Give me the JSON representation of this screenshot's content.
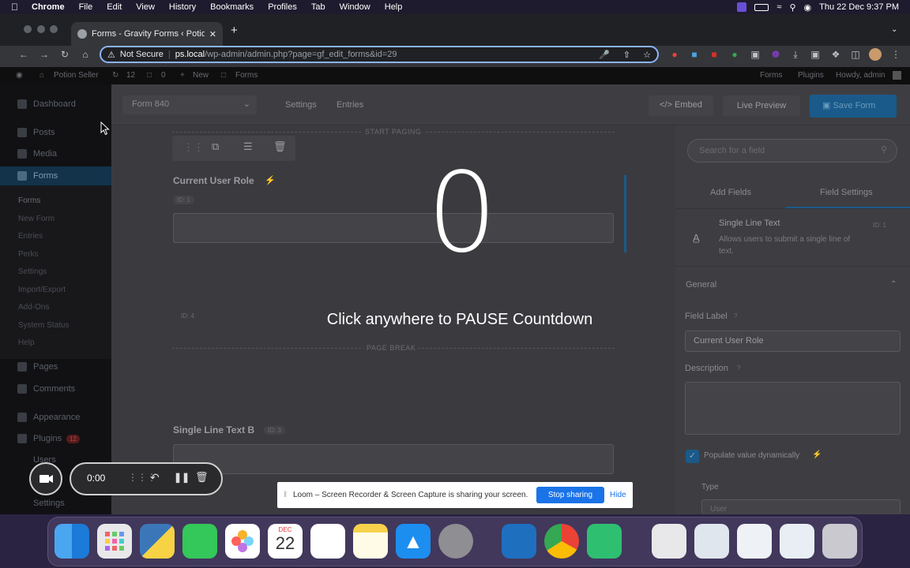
{
  "menubar": {
    "app": "Chrome",
    "items": [
      "File",
      "Edit",
      "View",
      "History",
      "Bookmarks",
      "Profiles",
      "Tab",
      "Window",
      "Help"
    ],
    "datetime": "Thu 22 Dec  9:37 PM"
  },
  "browser": {
    "tab_title": "Forms - Gravity Forms ‹ Potion",
    "security": "Not Secure",
    "url_host": "ps.local",
    "url_path": "/wp-admin/admin.php?page=gf_edit_forms&id=29"
  },
  "adminbar": {
    "site": "Potion Seller",
    "updates": "12",
    "comments": "0",
    "new": "New",
    "forms": "Forms",
    "right_forms": "Forms",
    "right_plugins": "Plugins",
    "howdy": "Howdy, admin"
  },
  "sidebar": {
    "dashboard": "Dashboard",
    "posts": "Posts",
    "media": "Media",
    "forms": "Forms",
    "forms_sub": [
      "Forms",
      "New Form",
      "Entries",
      "Perks",
      "Settings",
      "Import/Export",
      "Add-Ons",
      "System Status",
      "Help"
    ],
    "pages": "Pages",
    "comments": "Comments",
    "appearance": "Appearance",
    "plugins": "Plugins",
    "plugins_badge": "12",
    "users": "Users",
    "settings": "Settings"
  },
  "formheader": {
    "form_select": "Form 840",
    "settings": "Settings",
    "entries": "Entries",
    "embed": "Embed",
    "live_preview": "Live Preview",
    "save": "Save Form"
  },
  "canvas": {
    "start_paging": "START PAGING",
    "field1_label": "Current User Role",
    "field1_id": "ID: 1",
    "field4_id": "ID: 4",
    "page_break": "PAGE BREAK",
    "field3_label": "Single Line Text B",
    "field3_id": "ID: 3"
  },
  "panel": {
    "search_placeholder": "Search for a field",
    "tab_add": "Add Fields",
    "tab_settings": "Field Settings",
    "field_type": "Single Line Text",
    "field_type_id": "ID: 1",
    "field_type_desc": "Allows users to submit a single line of text.",
    "general": "General",
    "field_label_title": "Field Label",
    "field_label_value": "Current User Role",
    "description_title": "Description",
    "populate": "Populate value dynamically",
    "type_title": "Type",
    "type_value": "User"
  },
  "overlay": {
    "countdown": "0",
    "message": "Click anywhere to PAUSE Countdown"
  },
  "loom": {
    "timer": "0:00",
    "sharing_msg": "Loom – Screen Recorder & Screen Capture is sharing your screen.",
    "stop": "Stop sharing",
    "hide": "Hide"
  },
  "dock": {
    "calendar_month": "DEC",
    "calendar_day": "22"
  }
}
